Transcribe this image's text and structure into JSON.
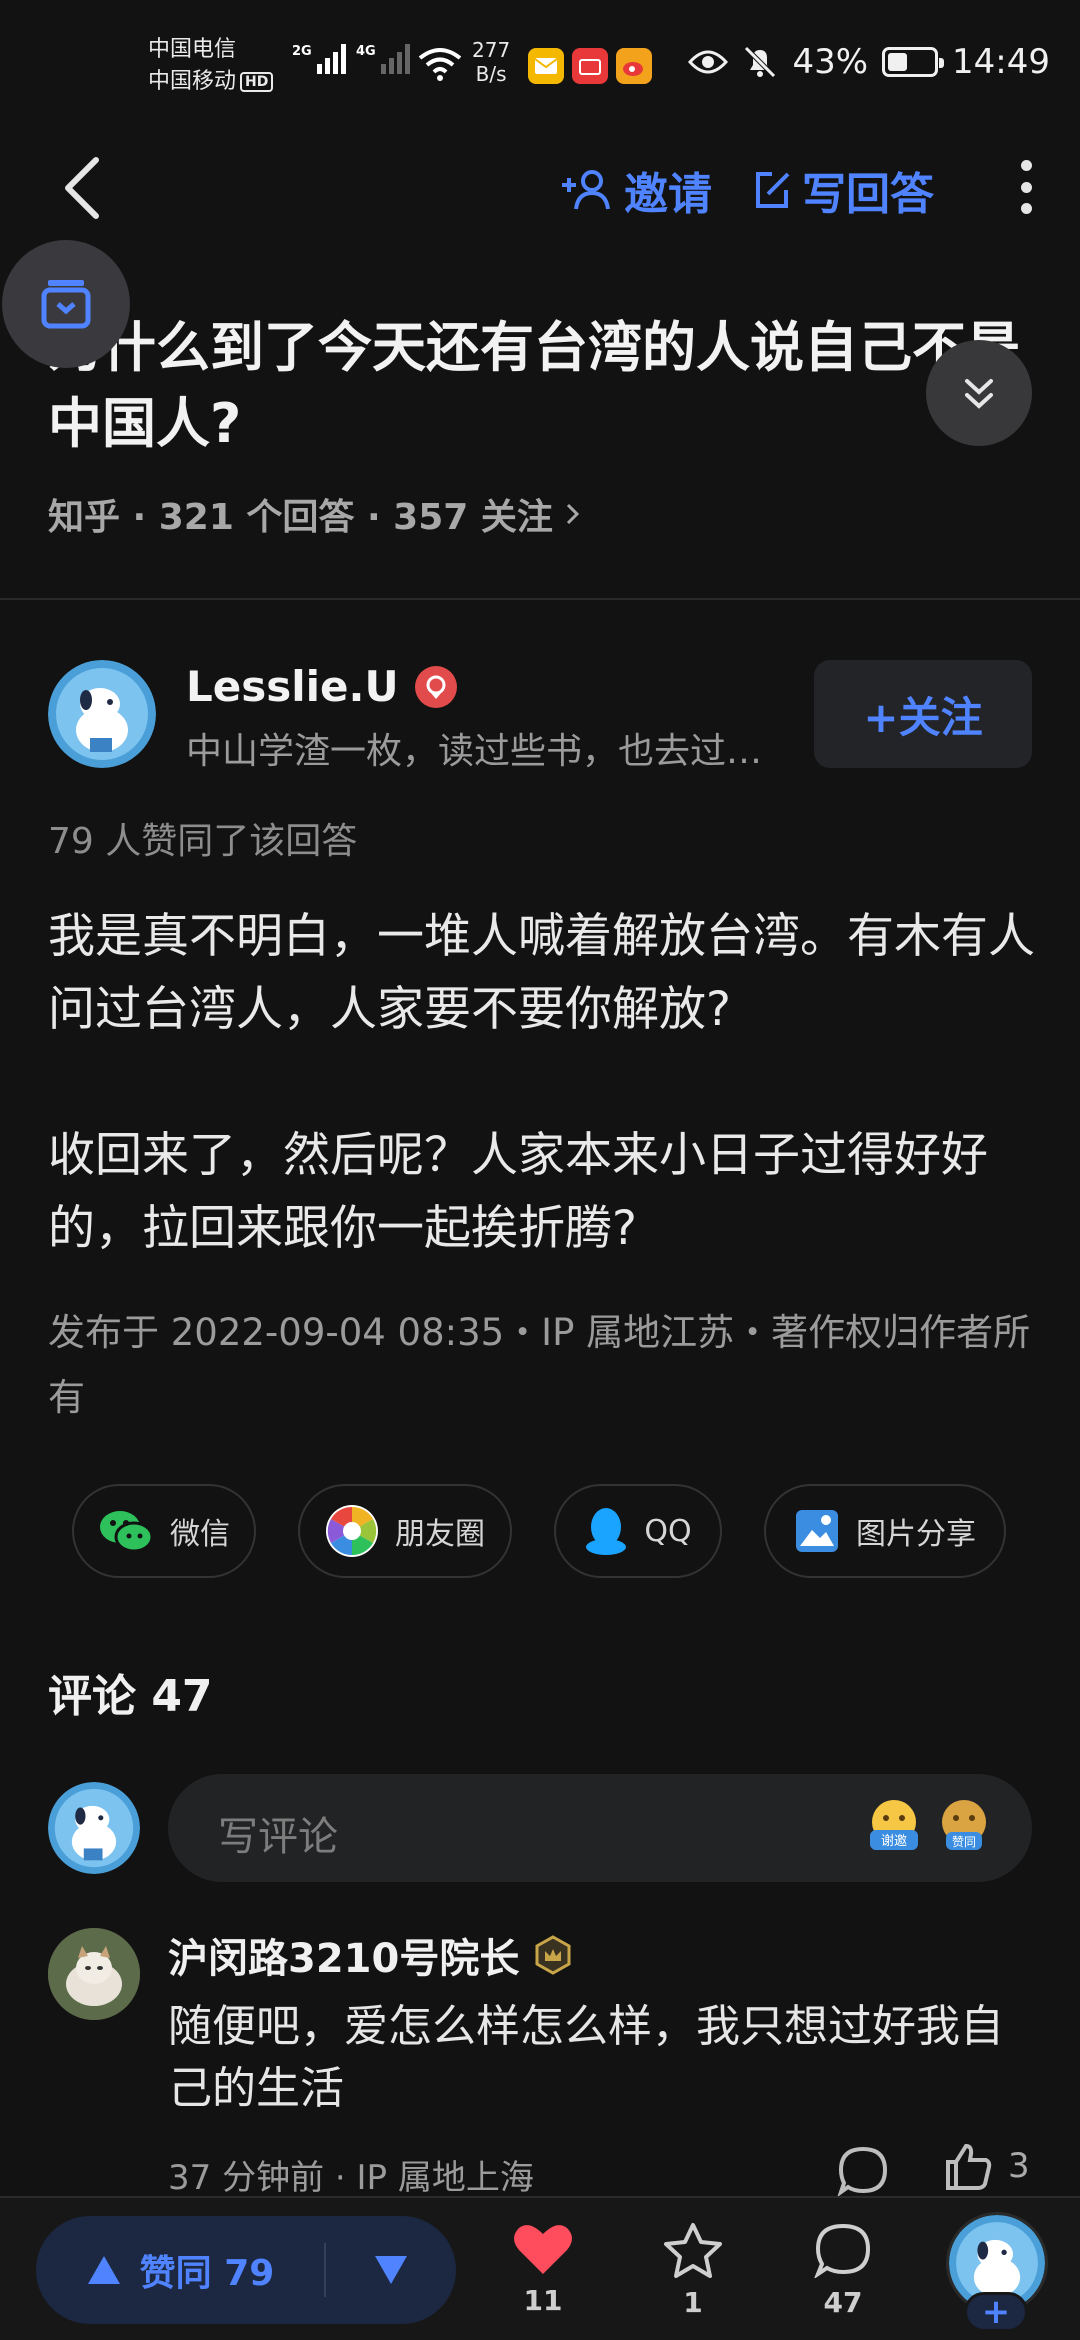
{
  "status_bar": {
    "carrier1": "中国电信",
    "carrier2": "中国移动",
    "hd": "HD",
    "net1": "2G",
    "net2": "4G",
    "speed_value": "277",
    "speed_unit": "B/s",
    "battery": "43%",
    "battery_level": 0.43,
    "time": "14:49"
  },
  "header": {
    "invite_label": "邀请",
    "write_answer_label": "写回答"
  },
  "question": {
    "title": "为什么到了今天还有台湾的人说自己不是中国人?",
    "meta": "知乎 · 321 个回答 · 357 关注"
  },
  "author": {
    "name": "Lesslie.U",
    "bio": "中山学渣一枚，读过些书，也去过一些地方",
    "follow_label": "+关注"
  },
  "answer": {
    "vote_summary": "79 人赞同了该回答",
    "paragraph1": "我是真不明白，一堆人喊着解放台湾。有木有人问过台湾人，人家要不要你解放?",
    "paragraph2": "收回来了，然后呢？人家本来小日子过得好好的，拉回来跟你一起挨折腾?",
    "publish_info": "发布于 2022-09-04 08:35・IP 属地江苏・著作权归作者所有"
  },
  "share": {
    "wechat": "微信",
    "moments": "朋友圈",
    "qq": "QQ",
    "image_share": "图片分享"
  },
  "comments": {
    "title": "评论 47",
    "input_placeholder": "写评论",
    "emoji1": "谢邀",
    "emoji2": "赞同",
    "items": [
      {
        "author": "沪闵路3210号院长",
        "text": "随便吧，爱怎么样怎么样，我只想过好我自己的生活",
        "meta": "37 分钟前 ·  IP 属地上海",
        "likes": "3"
      }
    ]
  },
  "bottom_bar": {
    "vote_label": "赞同 79",
    "likes_count": "11",
    "favorites_count": "1",
    "comments_count": "47",
    "plus": "+"
  },
  "colors": {
    "accent": "#4f83ff",
    "heart": "#ff4d5e",
    "background": "#121212"
  }
}
